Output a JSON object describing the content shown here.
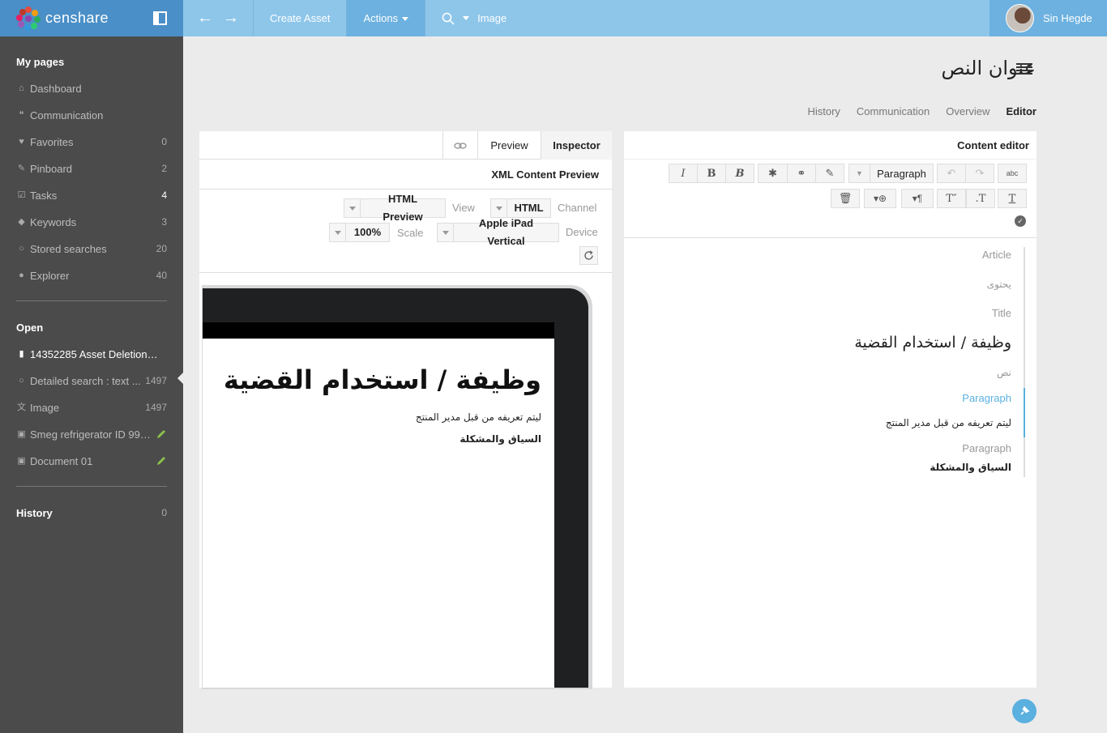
{
  "app": {
    "brand": "censhare"
  },
  "topbar": {
    "create_asset": "Create Asset",
    "actions": "Actions",
    "search_value": "Image",
    "user_name": "Sin Hegde"
  },
  "sidebar": {
    "my_pages_title": "My pages",
    "items": [
      {
        "label": "Dashboard",
        "icon": "home-icon",
        "count": ""
      },
      {
        "label": "Communication",
        "icon": "communication-icon",
        "count": ""
      },
      {
        "label": "Favorites",
        "icon": "heart-icon",
        "count": "0"
      },
      {
        "label": "Pinboard",
        "icon": "pin-icon",
        "count": "2"
      },
      {
        "label": "Tasks",
        "icon": "task-check-icon",
        "count": "4"
      },
      {
        "label": "Keywords",
        "icon": "tag-icon",
        "count": "3"
      },
      {
        "label": "Stored searches",
        "icon": "search-icon",
        "count": "20"
      },
      {
        "label": "Explorer",
        "icon": "compass-icon",
        "count": "40"
      }
    ],
    "open_title": "Open",
    "open_items": [
      {
        "label": "14352285 Asset Deletion R...",
        "icon": "clipboard-icon",
        "count": ""
      },
      {
        "label": "Detailed search : text ...",
        "icon": "search-icon",
        "count": "1497"
      },
      {
        "label": "Image",
        "icon": "translate-icon",
        "count": "1497"
      },
      {
        "label": "Smeg refrigerator ID 998...",
        "icon": "image-icon",
        "count": ""
      },
      {
        "label": "Document 01",
        "icon": "image-icon",
        "count": ""
      }
    ],
    "history_title": "History",
    "history_count": "0"
  },
  "page": {
    "title": "عنوان النص",
    "tabs": [
      "History",
      "Communication",
      "Overview",
      "Editor"
    ],
    "active_tab": "Editor"
  },
  "preview_panel": {
    "tab_preview": "Preview",
    "tab_inspector": "Inspector",
    "subtitle": "XML Content Preview",
    "view_value": "HTML Preview",
    "view_label": "View",
    "channel_value": "HTML",
    "channel_label": "Channel",
    "scale_value": "100%",
    "scale_label": "Scale",
    "device_value": "Apple iPad Vertical",
    "device_label": "Device",
    "heading": "وظيفة / استخدام القضية",
    "para1": "ليتم تعريفه من قبل مدير المنتج",
    "para2": "السياق والمشكلة"
  },
  "editor_panel": {
    "title": "Content editor",
    "paragraph_style": "Paragraph",
    "structure": {
      "article": "Article",
      "content": "يحتوى",
      "title_label": "Title",
      "title_text": "وظيفة / استخدام القضية",
      "text_label": "نص",
      "paragraph1_label": "Paragraph",
      "paragraph1_text": "ليتم تعريفه من قبل مدير المنتج",
      "paragraph2_label": "Paragraph",
      "paragraph2_text": "السياق والمشكلة"
    }
  }
}
